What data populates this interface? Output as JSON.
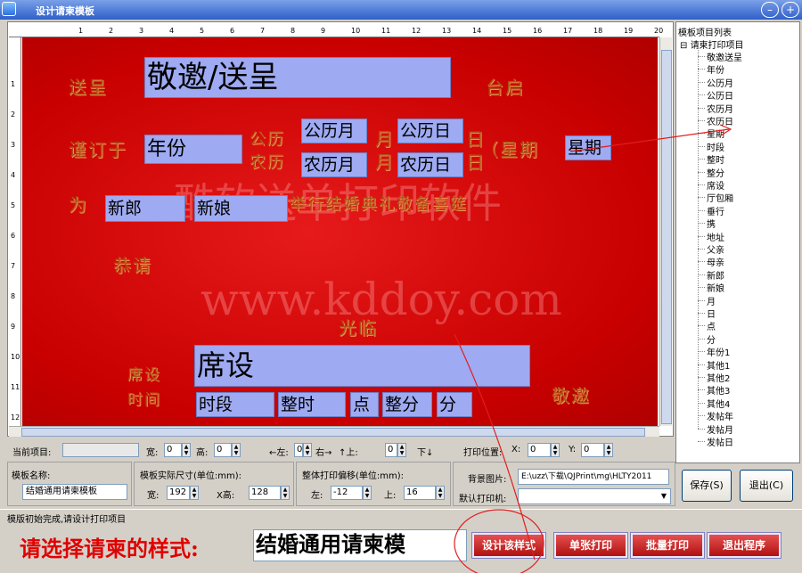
{
  "window": {
    "title": "设计请柬模板"
  },
  "ruler": {
    "h_ticks": [
      "1",
      "2",
      "3",
      "4",
      "5",
      "6",
      "7",
      "8",
      "9",
      "10",
      "11",
      "12",
      "13",
      "14",
      "15",
      "16",
      "17",
      "18",
      "19",
      "20"
    ],
    "v_ticks": [
      "1",
      "2",
      "3",
      "4",
      "5",
      "6",
      "7",
      "8",
      "9",
      "10",
      "11",
      "12"
    ]
  },
  "card": {
    "background_color": "#d00000",
    "printed_text": {
      "songcheng": "送呈",
      "taiqi": "台启",
      "jinding_yu": "谨订于",
      "gongli": "公历",
      "nongli": "农历",
      "yue1": "月",
      "yue2": "月",
      "ri1": "日",
      "ri2": "日",
      "xingqi": "（星期",
      "wei": "为",
      "wedding_text": "举行结婚典礼敬备喜筵",
      "gongqing": "恭请",
      "guanglin": "光临",
      "xiyan": "席设",
      "shijian": "时间",
      "jingyao": "敬邀"
    },
    "watermark": {
      "line1": "酷软送单打印软件",
      "line2": "www.kddoy.com"
    },
    "fields": {
      "jingyao_songcheng": "敬邀/送呈",
      "nianfen": "年份",
      "gongli_yue": "公历月",
      "gongli_ri": "公历日",
      "xingqi": "星期",
      "nongli_yue": "农历月",
      "nongli_ri": "农历日",
      "xinlang": "新郎",
      "xinniang": "新娘",
      "xishe": "席设",
      "shiduan": "时段",
      "zhengshi": "整时",
      "dian": "点",
      "zhengfen": "整分",
      "fen": "分"
    }
  },
  "tree": {
    "title": "模板项目列表",
    "root": "请柬打印项目",
    "items": [
      "敬邀送呈",
      "年份",
      "公历月",
      "公历日",
      "农历月",
      "农历日",
      "星期",
      "时段",
      "整时",
      "整分",
      "席设",
      "厅包厢",
      "垂行",
      "携",
      "地址",
      "父亲",
      "母亲",
      "新郎",
      "新娘",
      "月",
      "日",
      "点",
      "分",
      "年份1",
      "其他1",
      "其他2",
      "其他3",
      "其他4",
      "发帖年",
      "发帖月",
      "发帖日"
    ]
  },
  "props": {
    "current_item_label": "当前项目:",
    "width_label": "宽:",
    "width_value": "0",
    "height_label": "高:",
    "height_value": "0",
    "left_label": "←左:",
    "left_value": "0",
    "right_label": "右→",
    "up_label": "↑上:",
    "up_value": "0",
    "down_label": "下↓",
    "print_pos_label": "打印位置:",
    "x_label": "X:",
    "x_value": "0",
    "y_label": "Y:",
    "y_value": "0"
  },
  "template": {
    "name_label": "模板名称:",
    "name_value": "结婚通用请柬模板",
    "size_label": "模板实际尺寸(单位:mm):",
    "size_w_label": "宽:",
    "size_w_value": "192",
    "size_h_label": "X高:",
    "size_h_value": "128",
    "offset_label": "整体打印偏移(单位:mm):",
    "offset_left_label": "左:",
    "offset_left_value": "-12",
    "offset_top_label": "上:",
    "offset_top_value": "16",
    "bg_label": "背景图片:",
    "bg_value": "E:\\uzz\\下载\\QJPrint\\mg\\HLTY2011",
    "printer_label": "默认打印机:",
    "printer_value": "",
    "save_button": "保存(S)",
    "exit_button": "退出(C)"
  },
  "status": {
    "text": "模版初始完成,请设计打印项目"
  },
  "bottom": {
    "label": "请选择请柬的样式:",
    "selected": "结婚通用请柬模",
    "design_button": "设计该样式",
    "single_print_button": "单张打印",
    "batch_print_button": "批量打印",
    "exit_button": "退出程序"
  }
}
